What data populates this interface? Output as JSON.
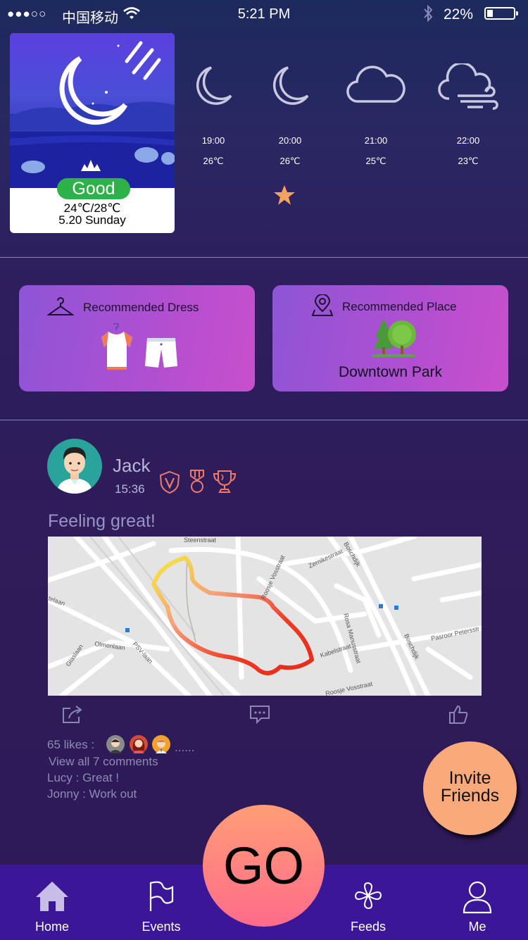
{
  "status_bar": {
    "signal": "●●●○○",
    "carrier": "中国移动",
    "time": "5:21 PM",
    "battery_percent": "22%",
    "battery_level": 0.22
  },
  "weather": {
    "quality": "Good",
    "temp_range": "24℃/28℃",
    "date": "5.20 Sunday",
    "forecast": [
      {
        "time": "19:00",
        "temp": "26℃",
        "icon": "moon-icon"
      },
      {
        "time": "20:00",
        "temp": "26℃",
        "icon": "moon-icon"
      },
      {
        "time": "21:00",
        "temp": "25℃",
        "icon": "cloud-icon"
      },
      {
        "time": "22:00",
        "temp": "23℃",
        "icon": "wind-cloud-icon"
      }
    ],
    "starred_index": 1
  },
  "recommendations": {
    "dress_title": "Recommended Dress",
    "place_title": "Recommended Place",
    "place_name": "Downtown Park"
  },
  "post": {
    "user": "Jack",
    "time": "15:36",
    "text": "Feeling great!",
    "likes": "65 likes :",
    "more": "......",
    "view_comments": "View all 7 comments",
    "comments": [
      "Lucy : Great !",
      "Jonny : Work out"
    ],
    "map_labels": [
      "Steenstraat",
      "Boschdijk",
      "Zernikestraat",
      "Rosa Manusstraat",
      "Kabelstraat",
      "Roosje Vosstraat",
      "Pasroor Petersstr",
      "Olmenlaan",
      "PSV-laan",
      "Glaslaan",
      "telaan",
      "Boschdijk",
      "Roosje Vosstraat"
    ]
  },
  "invite": {
    "line1": "Invite",
    "line2": "Friends"
  },
  "nav": {
    "home": "Home",
    "events": "Events",
    "go": "GO",
    "feeds": "Feeds",
    "me": "Me"
  }
}
